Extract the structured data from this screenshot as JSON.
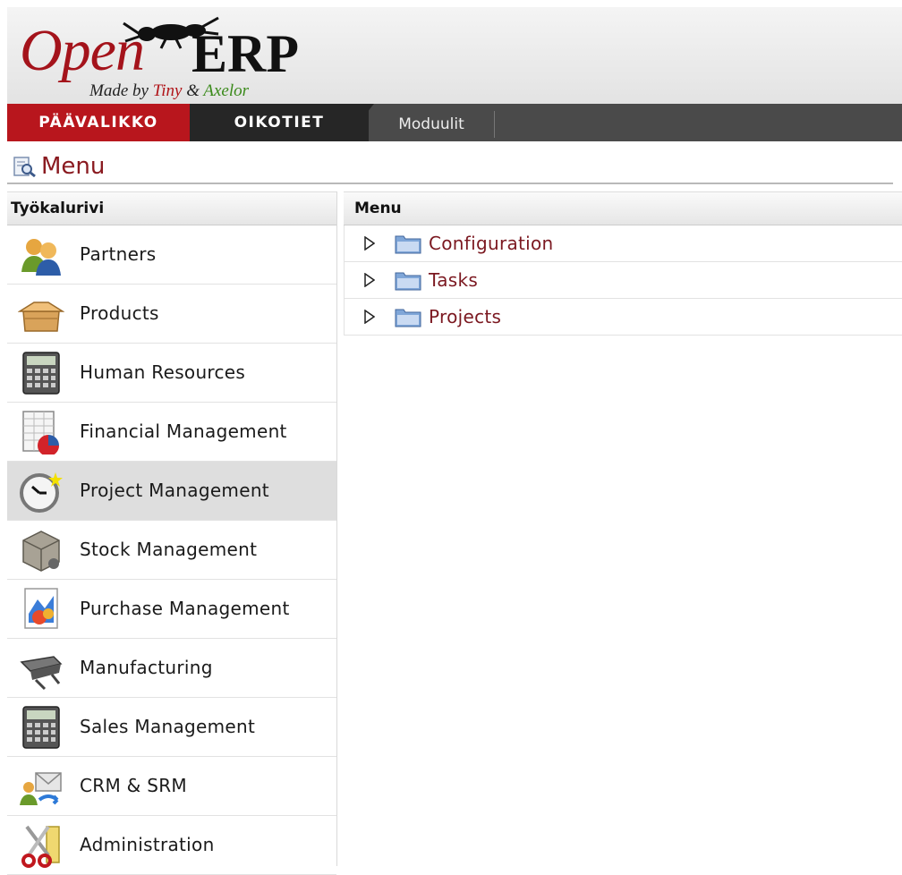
{
  "logo": {
    "open": "Open",
    "erp": "ERP",
    "made_by": "Made by",
    "tiny": "Tiny",
    "amp": "&",
    "axelor": "Axelor"
  },
  "nav": {
    "main_tab": "PÄÄVALIKKO",
    "shortcuts_tab": "OIKOTIET",
    "modules_tab": "Moduulit"
  },
  "page": {
    "title": "Menu",
    "title_icon": "magnifier-doc-icon"
  },
  "sidebar": {
    "heading": "Työkalurivi",
    "items": [
      {
        "label": "Partners",
        "icon": "partners-icon"
      },
      {
        "label": "Products",
        "icon": "box-icon"
      },
      {
        "label": "Human Resources",
        "icon": "calculator-icon"
      },
      {
        "label": "Financial Management",
        "icon": "spreadsheet-chart-icon"
      },
      {
        "label": "Project Management",
        "icon": "clock-icon",
        "active": true
      },
      {
        "label": "Stock Management",
        "icon": "stock-crate-icon"
      },
      {
        "label": "Purchase Management",
        "icon": "purchase-chart-icon"
      },
      {
        "label": "Manufacturing",
        "icon": "manufacturing-machine-icon"
      },
      {
        "label": "Sales Management",
        "icon": "calculator-icon"
      },
      {
        "label": "CRM & SRM",
        "icon": "crm-people-icon"
      },
      {
        "label": "Administration",
        "icon": "scissors-icon"
      }
    ]
  },
  "menu": {
    "heading": "Menu",
    "items": [
      {
        "label": "Configuration"
      },
      {
        "label": "Tasks"
      },
      {
        "label": "Projects"
      }
    ]
  },
  "colors": {
    "brand_red": "#b8161d",
    "nav_dark": "#4a4a4a",
    "link_maroon": "#7b1820",
    "active_row": "#dedede"
  }
}
